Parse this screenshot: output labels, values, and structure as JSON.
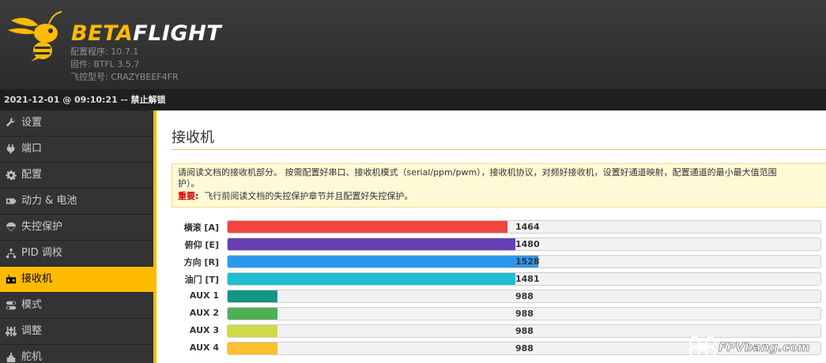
{
  "header": {
    "brand_part1": "BETA",
    "brand_part2": "FLIGHT",
    "configurator": "配置程序: 10.7.1",
    "firmware": "固件: BTFL 3.5.7",
    "board": "飞控型号: CRAZYBEEF4FR",
    "logo_icon": "hornet-logo-icon",
    "accent_color": "#ffbb00"
  },
  "statusbar": {
    "datetime": "2021-12-01 @ 09:10:21 --",
    "status": "禁止解锁"
  },
  "sidebar": {
    "items": [
      {
        "label": "设置",
        "icon": "wrench-icon"
      },
      {
        "label": "端口",
        "icon": "plug-icon"
      },
      {
        "label": "配置",
        "icon": "gear-icon"
      },
      {
        "label": "动力 & 电池",
        "icon": "battery-icon"
      },
      {
        "label": "失控保护",
        "icon": "parachute-icon"
      },
      {
        "label": "PID 调校",
        "icon": "pid-icon"
      },
      {
        "label": "接收机",
        "icon": "receiver-icon",
        "active": true
      },
      {
        "label": "模式",
        "icon": "toggle-icon"
      },
      {
        "label": "调整",
        "icon": "sliders-icon"
      },
      {
        "label": "舵机",
        "icon": "servo-icon"
      }
    ]
  },
  "main": {
    "title": "接收机",
    "notice_line1": "请阅读文档的接收机部分。 按需配置好串口、接收机模式（serial/ppm/pwm），接收机协议，对频好接收机，设置好通道映射，配置通道的最小最大值范围",
    "notice_line2": "护）。",
    "important_label": "重要:",
    "important_text": "飞行前阅读文档的失控保护章节并且配置好失控保护。"
  },
  "channels": {
    "min": 885,
    "max": 2115,
    "items": [
      {
        "label": "横滚 [A]",
        "value": "1464",
        "color": "#f1453d"
      },
      {
        "label": "俯仰 [E]",
        "value": "1480",
        "color": "#673fb4"
      },
      {
        "label": "方向 [R]",
        "value": "1528",
        "color": "#2b98f0"
      },
      {
        "label": "油门 [T]",
        "value": "1481",
        "color": "#1fbcd2"
      },
      {
        "label": "AUX 1",
        "value": "988",
        "color": "#159588"
      },
      {
        "label": "AUX 2",
        "value": "988",
        "color": "#50ae55"
      },
      {
        "label": "AUX 3",
        "value": "988",
        "color": "#cdda49"
      },
      {
        "label": "AUX 4",
        "value": "988",
        "color": "#fdc02f"
      }
    ]
  },
  "watermark": {
    "text": "FPVbang.com"
  }
}
